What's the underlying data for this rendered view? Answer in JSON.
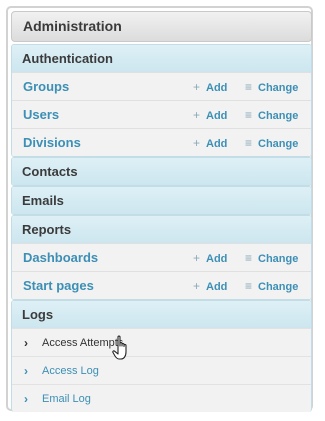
{
  "panel": {
    "title": "Administration"
  },
  "authentication": {
    "header": "Authentication",
    "rows": [
      {
        "label": "Groups",
        "add": "Add",
        "change": "Change"
      },
      {
        "label": "Users",
        "add": "Add",
        "change": "Change"
      },
      {
        "label": "Divisions",
        "add": "Add",
        "change": "Change"
      }
    ]
  },
  "contacts": {
    "header": "Contacts"
  },
  "emails": {
    "header": "Emails"
  },
  "reports": {
    "header": "Reports",
    "rows": [
      {
        "label": "Dashboards",
        "add": "Add",
        "change": "Change"
      },
      {
        "label": "Start pages",
        "add": "Add",
        "change": "Change"
      }
    ]
  },
  "logs": {
    "header": "Logs",
    "items": [
      {
        "label": "Access Attempts"
      },
      {
        "label": "Access Log"
      },
      {
        "label": "Email Log"
      }
    ]
  },
  "icons": {
    "add": "+",
    "change": "≡",
    "chevron": "›"
  },
  "colors": {
    "link": "#3c8fb5",
    "module_header": "#d6ebf2",
    "row_bg": "#f2f2f2"
  }
}
